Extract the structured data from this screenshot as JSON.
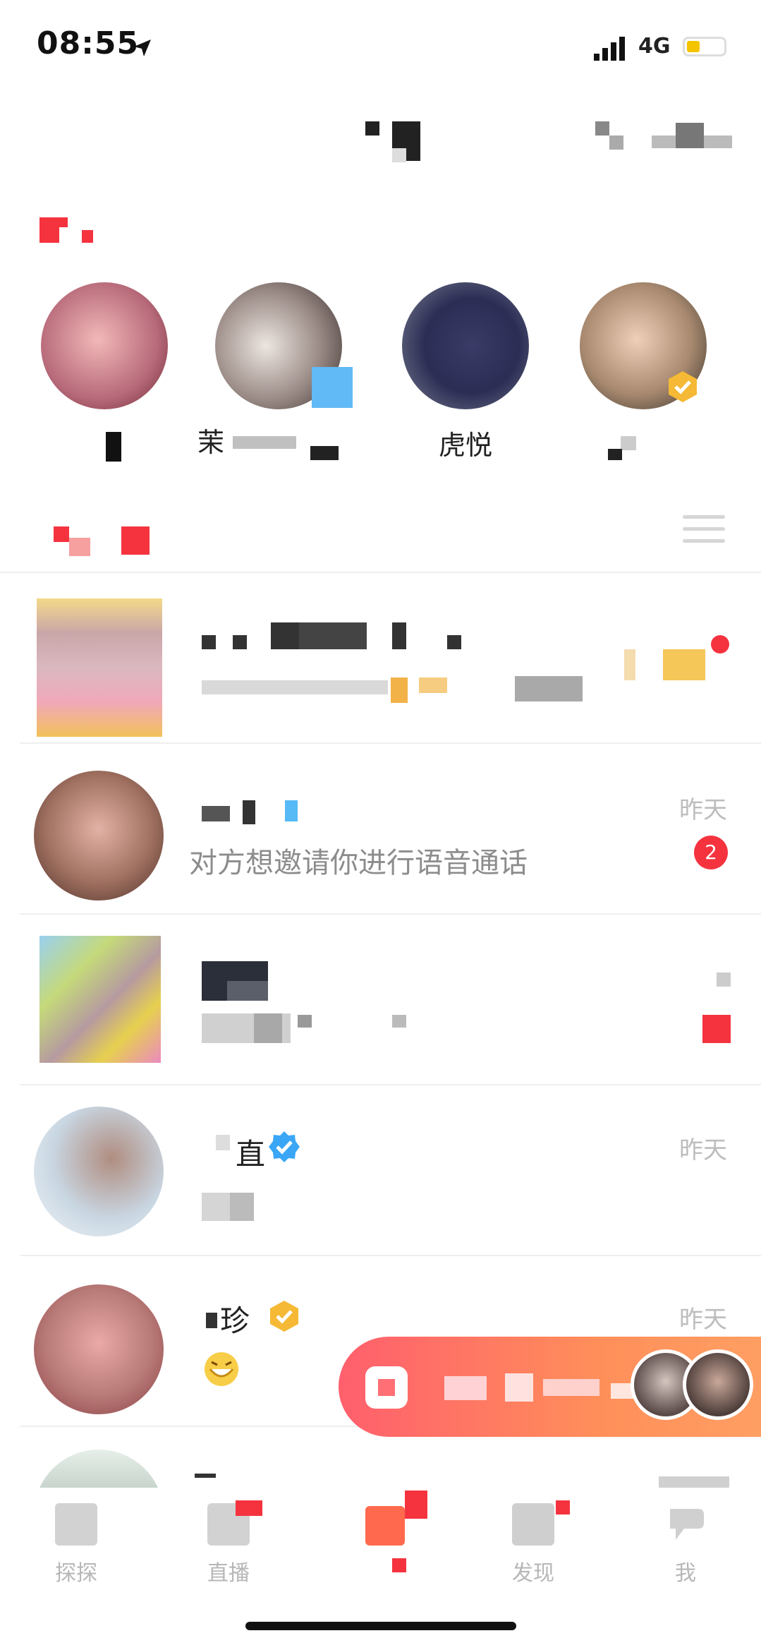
{
  "status_bar": {
    "time": "08:55",
    "network": "4G"
  },
  "online_contacts": [
    {
      "name": ""
    },
    {
      "name": "茉"
    },
    {
      "name": "虎悦"
    },
    {
      "name": ""
    }
  ],
  "messages": [
    {
      "text": "",
      "time": ""
    },
    {
      "text": "对方想邀请你进行语音通话",
      "time": "昨天",
      "badge": "2"
    },
    {
      "text": "",
      "time": ""
    },
    {
      "name_partial": "直",
      "text": "",
      "time": "昨天"
    },
    {
      "name_partial": "珍",
      "text": "",
      "time": "昨天"
    },
    {
      "text": "",
      "time": ""
    }
  ],
  "tabs": [
    {
      "label": "探探"
    },
    {
      "label": "直播"
    },
    {
      "label": ""
    },
    {
      "label": "发现"
    },
    {
      "label": "我"
    }
  ],
  "colors": {
    "accent": "#f5333f",
    "banner_start": "#ff5f6d",
    "banner_end": "#ffa064",
    "verified_blue": "#3aa6f5",
    "verified_gold": "#f5b935"
  }
}
